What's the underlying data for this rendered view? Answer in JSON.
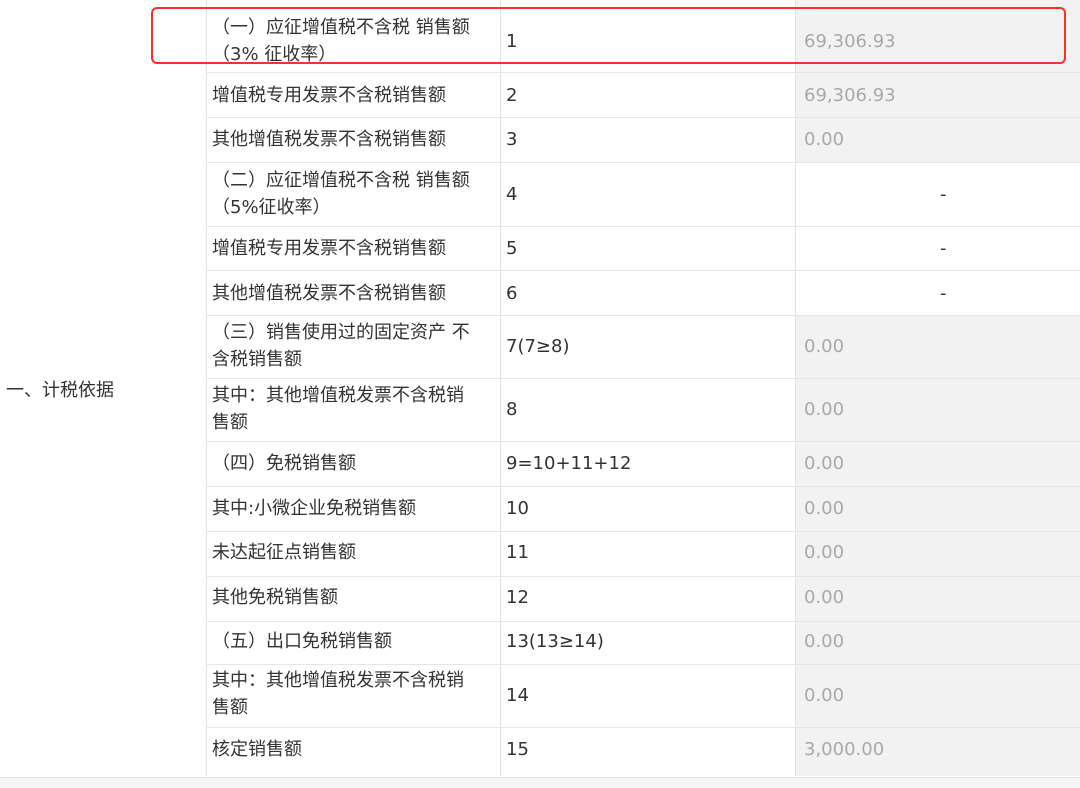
{
  "group_label": "一、计税依据",
  "rows": [
    {
      "label": "（一）应征增值税不含税 销售额\n（3% 征收率）",
      "code": "1",
      "value": "69,306.93"
    },
    {
      "label": "增值税专用发票不含税销售额",
      "code": "2",
      "value": "69,306.93"
    },
    {
      "label": "其他增值税发票不含税销售额",
      "code": "3",
      "value": "0.00"
    },
    {
      "label": "（二）应征增值税不含税 销售额\n（5%征收率）",
      "code": "4",
      "value": "-"
    },
    {
      "label": "增值税专用发票不含税销售额",
      "code": "5",
      "value": "-"
    },
    {
      "label": "其他增值税发票不含税销售额",
      "code": "6",
      "value": "-"
    },
    {
      "label": "（三）销售使用过的固定资产 不\n含税销售额",
      "code": "7(7≥8)",
      "value": "0.00"
    },
    {
      "label": "其中：其他增值税发票不含税销\n售额",
      "code": "8",
      "value": "0.00"
    },
    {
      "label": "（四）免税销售额",
      "code": "9=10+11+12",
      "value": "0.00"
    },
    {
      "label": "其中:小微企业免税销售额",
      "code": "10",
      "value": "0.00"
    },
    {
      "label": "未达起征点销售额",
      "code": "11",
      "value": "0.00"
    },
    {
      "label": "其他免税销售额",
      "code": "12",
      "value": "0.00"
    },
    {
      "label": "（五）出口免税销售额",
      "code": "13(13≥14)",
      "value": "0.00"
    },
    {
      "label": "其中：其他增值税发票不含税销\n售额",
      "code": "14",
      "value": "0.00"
    },
    {
      "label": "核定销售额",
      "code": "15",
      "value": "3,000.00"
    }
  ],
  "highlight_color": "#ff2f2f",
  "value_text_color": "#a9a9a9",
  "value_bg_color": "#f2f2f2"
}
